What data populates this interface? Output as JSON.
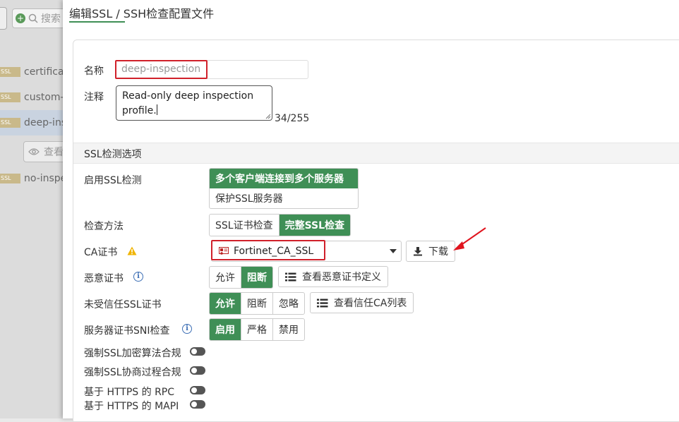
{
  "background_list": {
    "search_placeholder": "搜索",
    "rows": [
      {
        "badge": "SSL",
        "label": "certifica"
      },
      {
        "badge": "SSL",
        "label": "custom-"
      },
      {
        "badge": "SSL",
        "label": "deep-ins"
      },
      {
        "badge": "SSL",
        "label": "no-inspe"
      }
    ],
    "view_label": "查看"
  },
  "dialog": {
    "title": "编辑SSL / SSH检查配置文件",
    "name_label": "名称",
    "name_placeholder": "deep-inspection",
    "comment_label": "注释",
    "comment_value": "Read-only deep inspection profile.",
    "comment_counter": "34/255",
    "section_title": "SSL检测选项",
    "enable_ssl_label": "启用SSL检测",
    "enable_ssl_options": [
      "多个客户端连接到多个服务器",
      "保护SSL服务器"
    ],
    "enable_ssl_selected": "多个客户端连接到多个服务器",
    "inspection_method_label": "检查方法",
    "inspection_method_options": [
      "SSL证书检查",
      "完整SSL检查"
    ],
    "inspection_method_selected": "完整SSL检查",
    "ca_cert_label": "CA证书",
    "ca_cert_value": "Fortinet_CA_SSL",
    "download_label": "下载",
    "malicious_cert_label": "恶意证书",
    "malicious_cert_options": [
      "允许",
      "阻断"
    ],
    "malicious_cert_selected": "阻断",
    "malicious_cert_view_label": "查看恶意证书定义",
    "untrusted_cert_label": "未受信任SSL证书",
    "untrusted_cert_options": [
      "允许",
      "阻断",
      "忽略"
    ],
    "untrusted_cert_selected": "允许",
    "trusted_ca_view_label": "查看信任CA列表",
    "sni_check_label": "服务器证书SNI检查",
    "sni_check_options": [
      "启用",
      "严格",
      "禁用"
    ],
    "sni_check_selected": "启用",
    "toggles": [
      {
        "label": "强制SSL加密算法合规",
        "on": false
      },
      {
        "label": "强制SSL协商过程合规",
        "on": false
      },
      {
        "label": "基于 HTTPS 的 RPC",
        "on": false
      },
      {
        "label": "基于 HTTPS 的 MAPI",
        "on": false
      }
    ]
  },
  "colors": {
    "accent_green": "#3f8f56",
    "highlight_red": "#d0202a",
    "warning_yellow": "#f0b400",
    "info_blue": "#3d6fb5"
  }
}
